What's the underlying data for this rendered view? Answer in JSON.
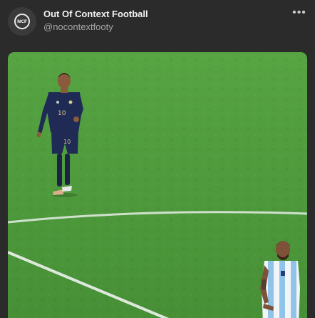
{
  "post": {
    "author_name": "Out Of Context Football",
    "author_handle": "@nocontextfooty",
    "avatar_logo_text": "NCF",
    "more_label": "•••"
  },
  "media": {
    "left_player_number": "10"
  },
  "colors": {
    "background": "#2b2b2b",
    "pitch": "#4e9a3c",
    "france_kit": "#1f2a55",
    "argentina_stripe": "#8fc3e8"
  },
  "icons": {
    "avatar": "ncf-logo-icon",
    "more": "more-horizontal-icon"
  }
}
